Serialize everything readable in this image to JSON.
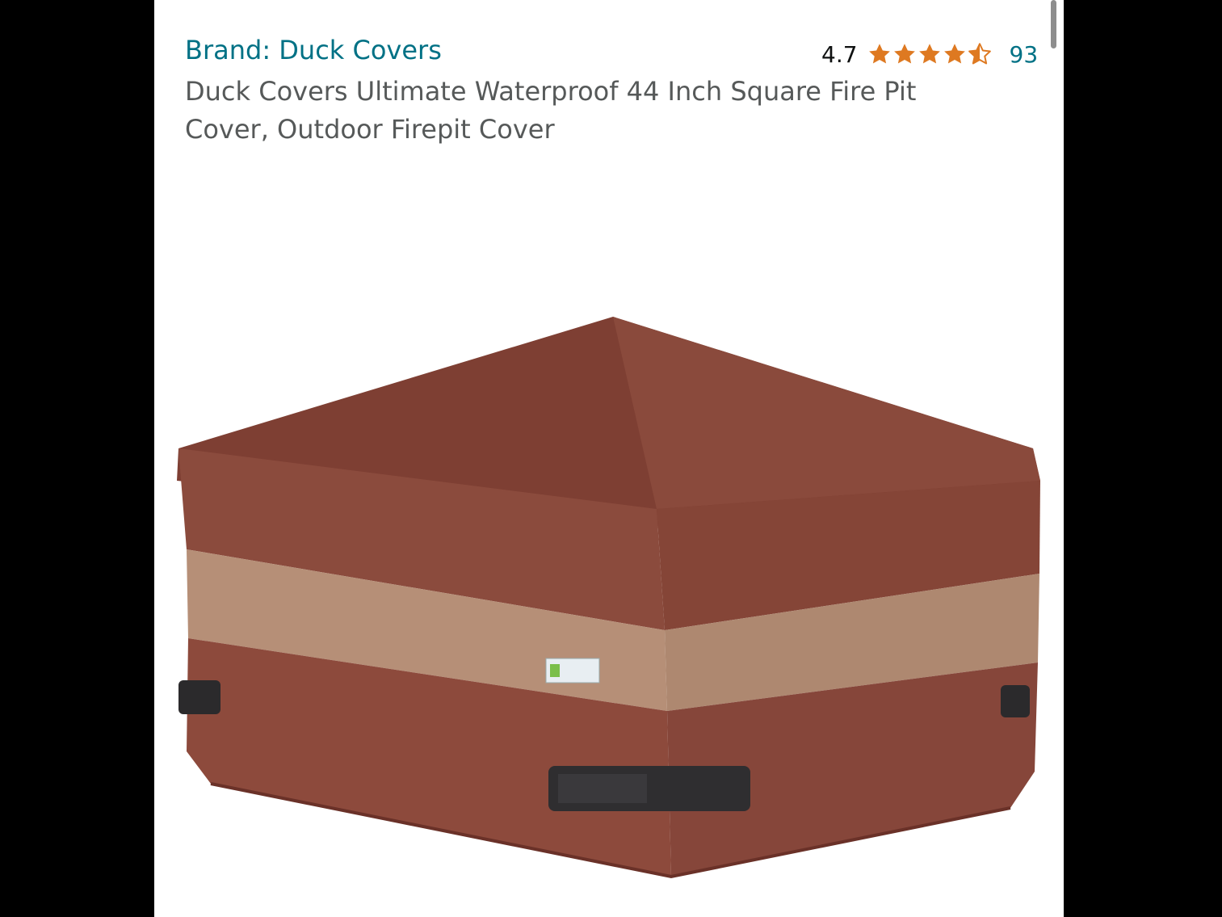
{
  "product": {
    "brand_link": "Brand: Duck Covers",
    "rating_value": "4.7",
    "rating_stars": 4.7,
    "rating_max": 5,
    "review_count": "93",
    "title": "Duck Covers Ultimate Waterproof 44 Inch Square Fire Pit Cover, Outdoor Firepit Cover"
  },
  "icons": {
    "star": "star-icon",
    "half_star": "half-star-icon"
  },
  "colors": {
    "link": "#007185",
    "star": "#de7921",
    "title": "#565959",
    "cover_brown": "#8a4a3a",
    "cover_band": "#b08a74"
  }
}
